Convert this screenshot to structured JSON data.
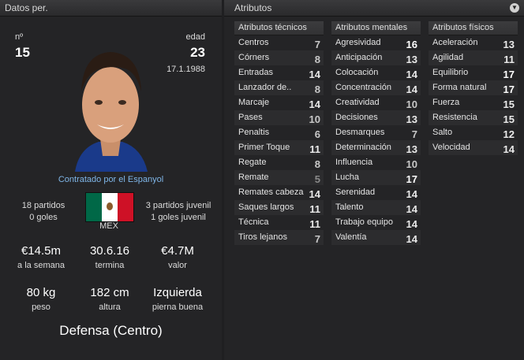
{
  "left_panel": {
    "title": "Datos per.",
    "number_label": "nº",
    "number": "15",
    "age_label": "edad",
    "age": "23",
    "birthdate": "17.1.1988",
    "contract_text": "Contratado por el Espanyol",
    "senior_matches": "18 partidos",
    "senior_goals": "0 goles",
    "youth_matches": "3 partidos juvenil",
    "youth_goals": "1 goles juvenil",
    "nation_code": "MEX",
    "wage_value": "€14.5m",
    "wage_label": "a la semana",
    "contract_end_value": "30.6.16",
    "contract_end_label": "termina",
    "value_value": "€4.7M",
    "value_label": "valor",
    "weight_value": "80 kg",
    "weight_label": "peso",
    "height_value": "182 cm",
    "height_label": "altura",
    "foot_value": "Izquierda",
    "foot_label": "pierna buena",
    "position": "Defensa (Centro)",
    "flag_colors": [
      "#006847",
      "#ffffff",
      "#ce1126"
    ]
  },
  "right_panel": {
    "title": "Atributos",
    "technical": {
      "header": "Atributos técnicos",
      "items": [
        {
          "name": "Centros",
          "value": "7"
        },
        {
          "name": "Córners",
          "value": "8"
        },
        {
          "name": "Entradas",
          "value": "14"
        },
        {
          "name": "Lanzador de..",
          "value": "8"
        },
        {
          "name": "Marcaje",
          "value": "14"
        },
        {
          "name": "Pases",
          "value": "10"
        },
        {
          "name": "Penaltis",
          "value": "6"
        },
        {
          "name": "Primer Toque",
          "value": "11"
        },
        {
          "name": "Regate",
          "value": "8"
        },
        {
          "name": "Remate",
          "value": "5"
        },
        {
          "name": "Remates cabeza",
          "value": "14"
        },
        {
          "name": "Saques largos",
          "value": "11"
        },
        {
          "name": "Técnica",
          "value": "11"
        },
        {
          "name": "Tiros lejanos",
          "value": "7"
        }
      ]
    },
    "mental": {
      "header": "Atributos mentales",
      "items": [
        {
          "name": "Agresividad",
          "value": "16"
        },
        {
          "name": "Anticipación",
          "value": "13"
        },
        {
          "name": "Colocación",
          "value": "14"
        },
        {
          "name": "Concentración",
          "value": "14"
        },
        {
          "name": "Creatividad",
          "value": "10"
        },
        {
          "name": "Decisiones",
          "value": "13"
        },
        {
          "name": "Desmarques",
          "value": "7"
        },
        {
          "name": "Determinación",
          "value": "13"
        },
        {
          "name": "Influencia",
          "value": "10"
        },
        {
          "name": "Lucha",
          "value": "17"
        },
        {
          "name": "Serenidad",
          "value": "14"
        },
        {
          "name": "Talento",
          "value": "14"
        },
        {
          "name": "Trabajo equipo",
          "value": "14"
        },
        {
          "name": "Valentía",
          "value": "14"
        }
      ]
    },
    "physical": {
      "header": "Atributos físicos",
      "items": [
        {
          "name": "Aceleración",
          "value": "13"
        },
        {
          "name": "Agilidad",
          "value": "11"
        },
        {
          "name": "Equilibrio",
          "value": "17"
        },
        {
          "name": "Forma natural",
          "value": "17"
        },
        {
          "name": "Fuerza",
          "value": "15"
        },
        {
          "name": "Resistencia",
          "value": "15"
        },
        {
          "name": "Salto",
          "value": "12"
        },
        {
          "name": "Velocidad",
          "value": "14"
        }
      ]
    }
  }
}
